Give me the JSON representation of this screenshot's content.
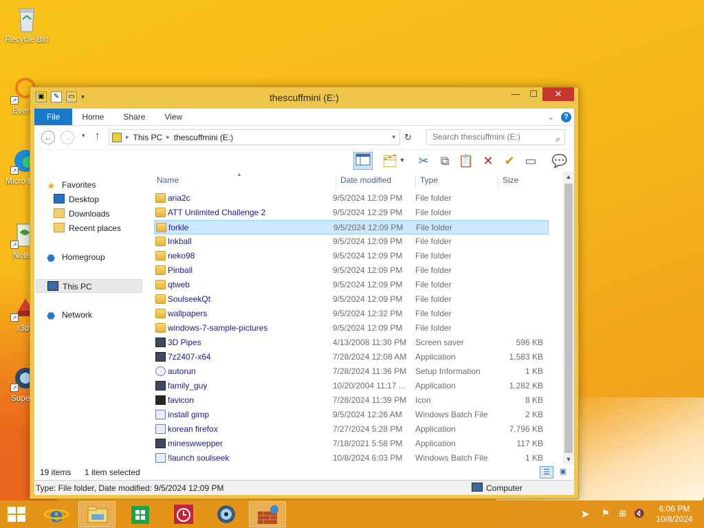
{
  "desktop": {
    "icons": [
      {
        "label": "Recycle Bin"
      },
      {
        "label": "Everyt"
      },
      {
        "label": "Micro Edg"
      },
      {
        "label": "Notep"
      },
      {
        "label": "r3dt"
      },
      {
        "label": "Supern"
      }
    ]
  },
  "window": {
    "title": "thescuffmini (E:)",
    "tabs": {
      "file": "File",
      "home": "Home",
      "share": "Share",
      "view": "View"
    },
    "help_label": "?",
    "address": {
      "this_pc": "This PC",
      "drive": "thescuffmini (E:)"
    },
    "search_placeholder": "Search thescuffmini (E:)"
  },
  "nav": {
    "favorites": "Favorites",
    "desktop": "Desktop",
    "downloads": "Downloads",
    "recent": "Recent places",
    "homegroup": "Homegroup",
    "this_pc": "This PC",
    "network": "Network"
  },
  "columns": {
    "name": "Name",
    "date": "Date modified",
    "type": "Type",
    "size": "Size"
  },
  "files": [
    {
      "name": "aria2c",
      "date": "9/5/2024 12:09 PM",
      "type": "File folder",
      "size": "",
      "icon": "folder"
    },
    {
      "name": "ATT Unlimited Challenge 2",
      "date": "9/5/2024 12:29 PM",
      "type": "File folder",
      "size": "",
      "icon": "folder"
    },
    {
      "name": "forkle",
      "date": "9/5/2024 12:09 PM",
      "type": "File folder",
      "size": "",
      "icon": "folder"
    },
    {
      "name": "Inkball",
      "date": "9/5/2024 12:09 PM",
      "type": "File folder",
      "size": "",
      "icon": "folder"
    },
    {
      "name": "neko98",
      "date": "9/5/2024 12:09 PM",
      "type": "File folder",
      "size": "",
      "icon": "folder"
    },
    {
      "name": "Pinball",
      "date": "9/5/2024 12:09 PM",
      "type": "File folder",
      "size": "",
      "icon": "folder"
    },
    {
      "name": "qtweb",
      "date": "9/5/2024 12:09 PM",
      "type": "File folder",
      "size": "",
      "icon": "folder"
    },
    {
      "name": "SoulseekQt",
      "date": "9/5/2024 12:09 PM",
      "type": "File folder",
      "size": "",
      "icon": "folder"
    },
    {
      "name": "wallpapers",
      "date": "9/5/2024 12:32 PM",
      "type": "File folder",
      "size": "",
      "icon": "folder"
    },
    {
      "name": "windows-7-sample-pictures",
      "date": "9/5/2024 12:09 PM",
      "type": "File folder",
      "size": "",
      "icon": "folder"
    },
    {
      "name": "3D Pipes",
      "date": "4/13/2008 11:30 PM",
      "type": "Screen saver",
      "size": "596 KB",
      "icon": "app"
    },
    {
      "name": "7z2407-x64",
      "date": "7/28/2024 12:08 AM",
      "type": "Application",
      "size": "1,583 KB",
      "icon": "app"
    },
    {
      "name": "autorun",
      "date": "7/28/2024 11:36 PM",
      "type": "Setup Information",
      "size": "1 KB",
      "icon": "setup"
    },
    {
      "name": "family_guy",
      "date": "10/20/2004 11:17 ...",
      "type": "Application",
      "size": "1,282 KB",
      "icon": "app"
    },
    {
      "name": "favicon",
      "date": "7/28/2024 11:39 PM",
      "type": "Icon",
      "size": "8 KB",
      "icon": "ico"
    },
    {
      "name": "install gimp",
      "date": "9/5/2024 12:26 AM",
      "type": "Windows Batch File",
      "size": "2 KB",
      "icon": "bat"
    },
    {
      "name": "korean firefox",
      "date": "7/27/2024 5:28 PM",
      "type": "Application",
      "size": "7,796 KB",
      "icon": "bat"
    },
    {
      "name": "mineswwepper",
      "date": "7/18/2021 5:58 PM",
      "type": "Application",
      "size": "117 KB",
      "icon": "app"
    },
    {
      "name": "!launch soulseek",
      "date": "10/8/2024 6:03 PM",
      "type": "Windows Batch File",
      "size": "1 KB",
      "icon": "bat"
    }
  ],
  "selected_index": 2,
  "status": {
    "count": "19 items",
    "selected": "1 item selected"
  },
  "details": {
    "text": "Type: File folder, Date modified: 9/5/2024 12:09 PM",
    "location": "Computer"
  },
  "clock": {
    "time": "6:06 PM",
    "date": "10/8/2024"
  },
  "colors": {
    "accent": "#1979ca",
    "selection": "#cce8ff",
    "link": "#1a1a8c"
  }
}
